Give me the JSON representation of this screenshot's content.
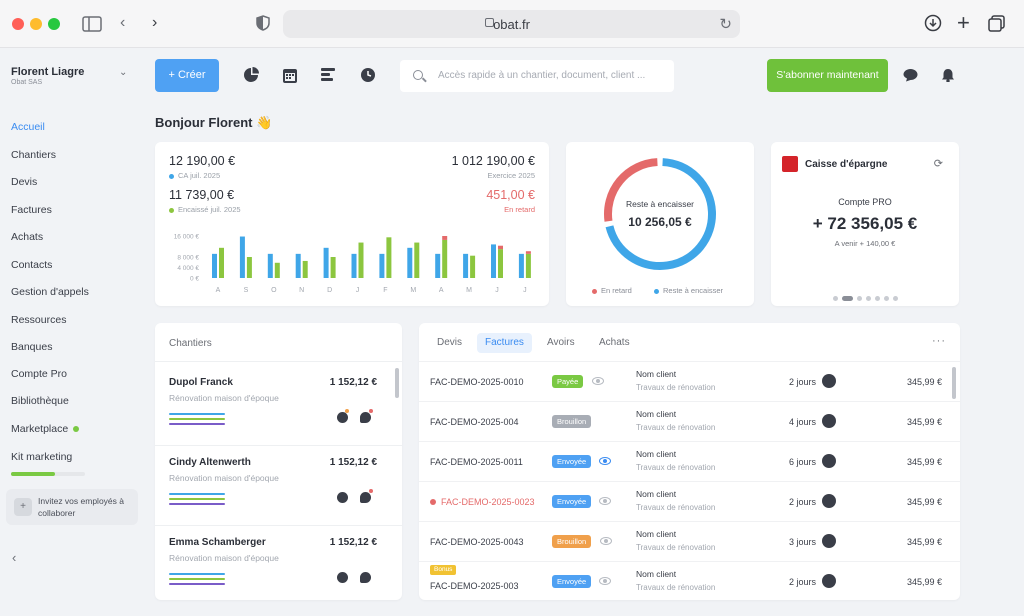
{
  "browser": {
    "url": "obat.fr"
  },
  "sidebar": {
    "user_name": "Florent Liagre",
    "company": "Obat SAS",
    "items": [
      {
        "label": "Accueil",
        "active": true
      },
      {
        "label": "Chantiers"
      },
      {
        "label": "Devis"
      },
      {
        "label": "Factures"
      },
      {
        "label": "Achats"
      },
      {
        "label": "Contacts"
      },
      {
        "label": "Gestion d'appels"
      },
      {
        "label": "Ressources"
      },
      {
        "label": "Banques"
      },
      {
        "label": "Compte Pro"
      },
      {
        "label": "Bibliothèque"
      },
      {
        "label": "Marketplace"
      },
      {
        "label": "Kit marketing"
      }
    ],
    "kit_progress": 0.6,
    "invite_text": "Invitez vos employés à collaborer"
  },
  "toolbar": {
    "create_label": "+ Créer",
    "search_placeholder": "Accès rapide à un chantier, document, client ...",
    "subscribe_label": "S'abonner maintenant"
  },
  "greeting": "Bonjour Florent 👋",
  "stats": {
    "ca_value": "12 190,00 €",
    "ca_label": "CA juil. 2025",
    "encaisse_value": "11 739,00 €",
    "encaisse_label": "Encaissé juil. 2025",
    "exercice_value": "1 012 190,00 €",
    "exercice_label": "Exercice 2025",
    "retard_value": "451,00 €",
    "retard_label": "En retard",
    "colors": {
      "blue": "#3fa6e8",
      "green": "#8cc63f",
      "red": "#e46a6a"
    }
  },
  "chart_data": {
    "type": "bar",
    "categories": [
      "A",
      "S",
      "O",
      "N",
      "D",
      "J",
      "F",
      "M",
      "A",
      "M",
      "J",
      "J"
    ],
    "y_ticks": [
      "16 000 €",
      "8 000 €",
      "4 000 €",
      "0 €"
    ],
    "ylim": [
      0,
      16000
    ],
    "series": [
      {
        "name": "CA",
        "color": "#3fa6e8",
        "values": [
          9200,
          15800,
          9200,
          9200,
          11500,
          9200,
          9200,
          11500,
          9200,
          9200,
          12800,
          9200
        ]
      },
      {
        "name": "Encaissé",
        "color": "#8cc63f",
        "values": [
          11500,
          8000,
          5800,
          6500,
          8000,
          13500,
          15500,
          13500,
          14500,
          8500,
          11000,
          9200
        ]
      },
      {
        "name": "En retard",
        "color": "#e46a6a",
        "values": [
          0,
          0,
          0,
          0,
          0,
          0,
          0,
          0,
          1500,
          0,
          1300,
          1000
        ]
      }
    ]
  },
  "donut": {
    "label": "Reste à encaisser",
    "value": "10 256,05 €",
    "legend_late": "En retard",
    "legend_remaining": "Reste à encaisser",
    "late_fraction": 0.28
  },
  "bank": {
    "name": "Caisse d'épargne",
    "account": "Compte PRO",
    "balance": "+ 72 356,05 €",
    "upcoming": "A venir + 140,00 €",
    "pages": 7,
    "active_page": 1
  },
  "chantiers": {
    "title": "Chantiers",
    "items": [
      {
        "name": "Dupol Franck",
        "amount": "1 152,12 €",
        "desc": "Rénovation maison d'époque"
      },
      {
        "name": "Cindy Altenwerth",
        "amount": "1 152,12 €",
        "desc": "Rénovation maison d'époque"
      },
      {
        "name": "Emma Schamberger",
        "amount": "1 152,12 €",
        "desc": "Rénovation maison d'époque"
      }
    ]
  },
  "documents": {
    "tabs": [
      "Devis",
      "Factures",
      "Avoirs",
      "Achats"
    ],
    "active_tab": 1,
    "rows": [
      {
        "number": "FAC-DEMO-2025-0010",
        "status": "Payée",
        "status_color": "#7ac943",
        "client": "Nom client",
        "work": "Travaux de rénovation",
        "due": "2 jours",
        "amount": "345,99 €"
      },
      {
        "number": "FAC-DEMO-2025-004",
        "status": "Brouillon",
        "status_color": "#a8adb5",
        "client": "Nom client",
        "work": "Travaux de rénovation",
        "due": "4 jours",
        "amount": "345,99 €"
      },
      {
        "number": "FAC-DEMO-2025-0011",
        "status": "Envoyée",
        "status_color": "#4fa1f3",
        "client": "Nom client",
        "work": "Travaux de rénovation",
        "due": "6 jours",
        "amount": "345,99 €"
      },
      {
        "number": "FAC-DEMO-2025-0023",
        "status": "Envoyée",
        "status_color": "#4fa1f3",
        "client": "Nom client",
        "work": "Travaux de rénovation",
        "due": "2 jours",
        "amount": "345,99 €",
        "late": true
      },
      {
        "number": "FAC-DEMO-2025-0043",
        "status": "Brouillon",
        "status_color": "#f0a04b",
        "client": "Nom client",
        "work": "Travaux de rénovation",
        "due": "3 jours",
        "amount": "345,99 €"
      },
      {
        "number": "FAC-DEMO-2025-003",
        "status": "Envoyée",
        "status_color": "#4fa1f3",
        "client": "Nom client",
        "work": "Travaux de rénovation",
        "due": "2 jours",
        "amount": "345,99 €",
        "premium": "Bonus"
      }
    ]
  }
}
